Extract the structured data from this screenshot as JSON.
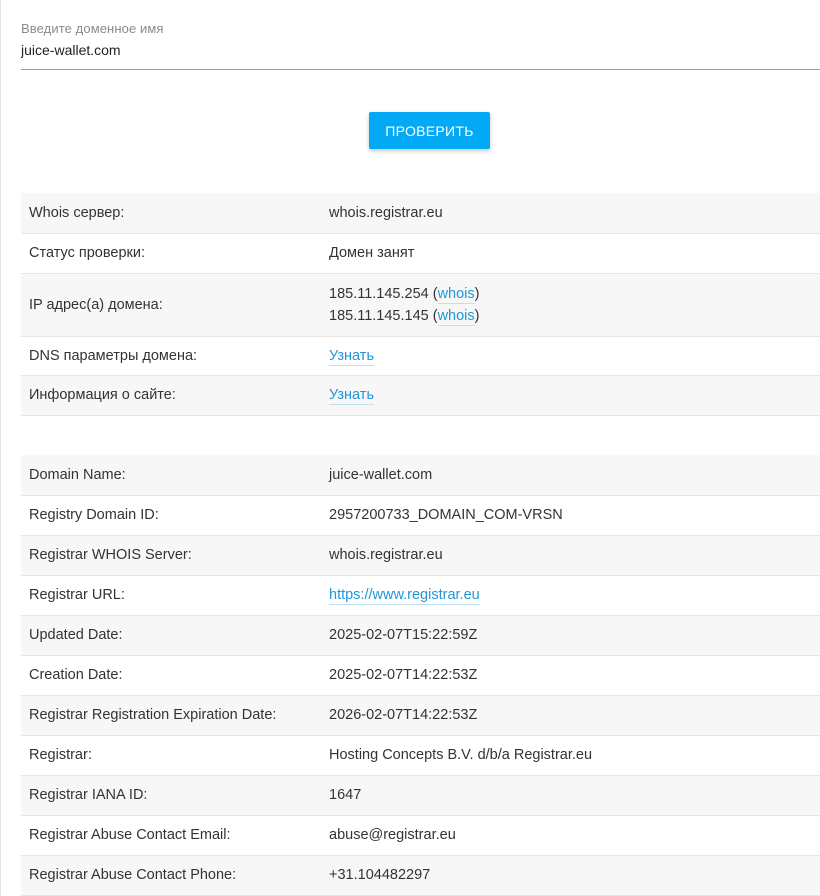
{
  "form": {
    "label": "Введите доменное имя",
    "value": "juice-wallet.com",
    "button": "ПРОВЕРИТЬ"
  },
  "summary": {
    "whois_server": {
      "label": "Whois сервер:",
      "value": "whois.registrar.eu"
    },
    "status": {
      "label": "Статус проверки:",
      "value": "Домен занят"
    },
    "ips": {
      "label": "IP адрес(а) домена:",
      "items": [
        {
          "ip": "185.11.145.254",
          "open": " (",
          "link": "whois",
          "close": ")"
        },
        {
          "ip": "185.11.145.145",
          "open": " (",
          "link": "whois",
          "close": ")"
        }
      ]
    },
    "dns": {
      "label": "DNS параметры домена:",
      "link": "Узнать"
    },
    "site": {
      "label": "Информация о сайте:",
      "link": "Узнать"
    }
  },
  "whois": [
    {
      "label": "Domain Name:",
      "value": "juice-wallet.com"
    },
    {
      "label": "Registry Domain ID:",
      "value": "2957200733_DOMAIN_COM-VRSN"
    },
    {
      "label": "Registrar WHOIS Server:",
      "value": "whois.registrar.eu"
    },
    {
      "label": "Registrar URL:",
      "value": "https://www.registrar.eu",
      "link": true
    },
    {
      "label": "Updated Date:",
      "value": "2025-02-07T15:22:59Z"
    },
    {
      "label": "Creation Date:",
      "value": "2025-02-07T14:22:53Z"
    },
    {
      "label": "Registrar Registration Expiration Date:",
      "value": "2026-02-07T14:22:53Z"
    },
    {
      "label": "Registrar:",
      "value": "Hosting Concepts B.V. d/b/a Registrar.eu"
    },
    {
      "label": "Registrar IANA ID:",
      "value": "1647"
    },
    {
      "label": "Registrar Abuse Contact Email:",
      "value": "abuse@registrar.eu"
    },
    {
      "label": "Registrar Abuse Contact Phone:",
      "value": "+31.104482297"
    }
  ],
  "colors": {
    "accent": "#03a9f4",
    "link": "#2196d8",
    "row_alt": "#f7f7f7"
  }
}
